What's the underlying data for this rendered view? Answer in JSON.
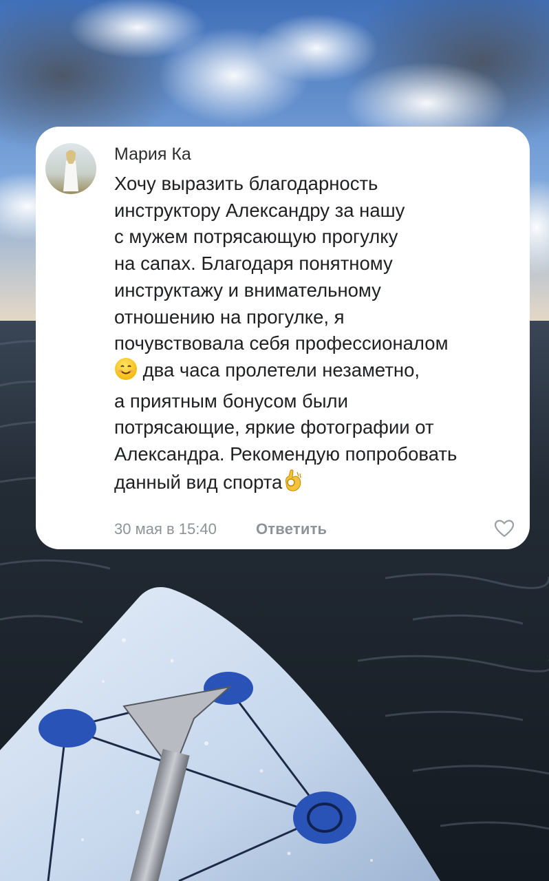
{
  "comment": {
    "author": "Мария Ка",
    "lines": [
      "Хочу выразить благодарность",
      "инструктору Александру за нашу",
      "с мужем потрясающую  прогулку",
      "на сапах. Благодаря понятному",
      "инструктажу и внимательному",
      "отношению на прогулке, я",
      "почувствовала себя профессионалом",
      "два часа пролетели незаметно,",
      "а приятным бонусом были",
      "потрясающие, яркие фотографии от",
      "Александра. Рекомендую попробовать",
      "данный вид спорта"
    ],
    "emojis": {
      "smile": "smiling-face-emoji",
      "ok": "ok-hand-emoji"
    },
    "date": "30 мая в 15:40",
    "reply_label": "Ответить",
    "like_icon": "heart-outline-icon"
  },
  "background": {
    "description_icons": [
      "sup-board-icon",
      "paddle-icon"
    ],
    "colors": {
      "sky": "#5d8fd6",
      "water": "#1f2630",
      "board": "#c8d9ee",
      "handles": "#2a53b8"
    }
  }
}
